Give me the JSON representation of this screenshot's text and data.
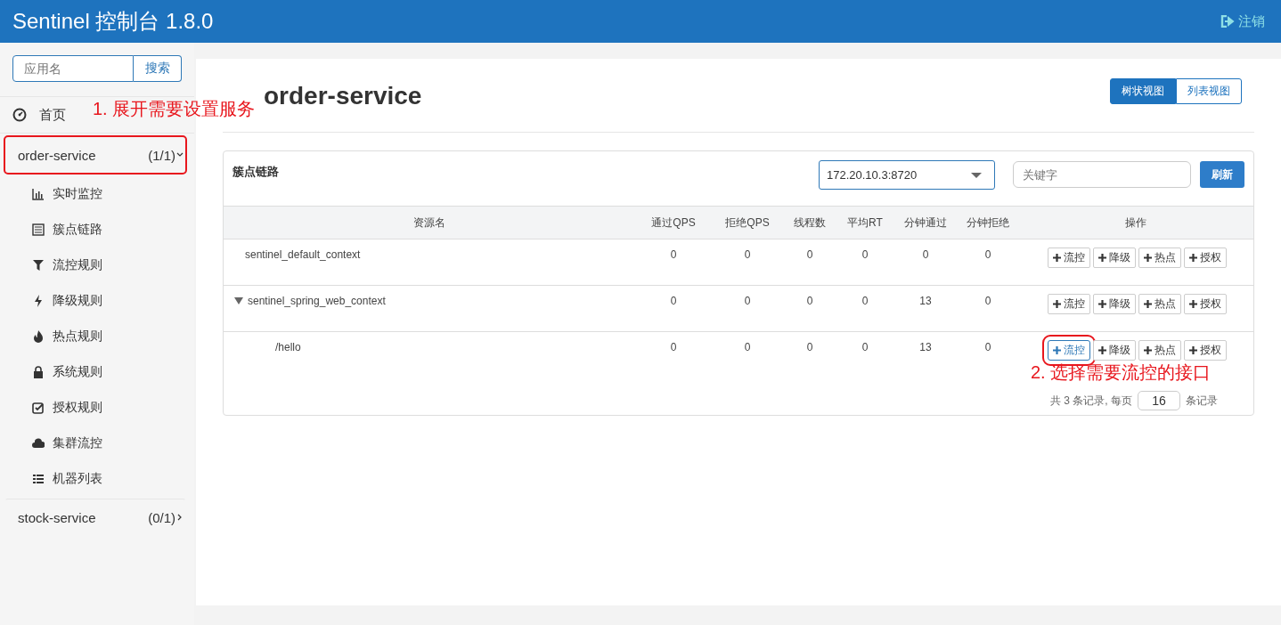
{
  "header": {
    "title": "Sentinel 控制台 1.8.0",
    "logout": "注销"
  },
  "sidebar": {
    "search": {
      "placeholder": "应用名",
      "button": "搜索"
    },
    "home": "首页",
    "apps": [
      {
        "name": "order-service",
        "count": "(1/1)",
        "expanded": true,
        "highlighted": true,
        "menu": [
          "实时监控",
          "簇点链路",
          "流控规则",
          "降级规则",
          "热点规则",
          "系统规则",
          "授权规则",
          "集群流控",
          "机器列表"
        ]
      },
      {
        "name": "stock-service",
        "count": "(0/1)",
        "expanded": false,
        "highlighted": false
      }
    ]
  },
  "page": {
    "title": "order-service",
    "views": [
      {
        "label": "树状视图",
        "selected": true
      },
      {
        "label": "列表视图",
        "selected": false
      }
    ]
  },
  "panel": {
    "title": "簇点链路",
    "machine": "172.20.10.3:8720",
    "keyword_placeholder": "关键字",
    "refresh": "刷新",
    "columns": [
      "资源名",
      "通过QPS",
      "拒绝QPS",
      "线程数",
      "平均RT",
      "分钟通过",
      "分钟拒绝",
      "操作"
    ],
    "rows": [
      {
        "name": "sentinel_default_context",
        "values": [
          "0",
          "0",
          "0",
          "0",
          "0",
          "0"
        ],
        "actions": [
          {
            "label": "流控",
            "selected": false,
            "highlighted": false
          },
          {
            "label": "降级",
            "selected": false,
            "highlighted": false
          },
          {
            "label": "热点",
            "selected": false,
            "highlighted": false
          },
          {
            "label": "授权",
            "selected": false,
            "highlighted": false
          }
        ]
      },
      {
        "name": "sentinel_spring_web_context",
        "expanded": true,
        "values": [
          "0",
          "0",
          "0",
          "0",
          "13",
          "0"
        ],
        "actions": [
          {
            "label": "流控",
            "selected": false,
            "highlighted": false
          },
          {
            "label": "降级",
            "selected": false,
            "highlighted": false
          },
          {
            "label": "热点",
            "selected": false,
            "highlighted": false
          },
          {
            "label": "授权",
            "selected": false,
            "highlighted": false
          }
        ],
        "children": [
          {
            "name": "/hello",
            "values": [
              "0",
              "0",
              "0",
              "0",
              "13",
              "0"
            ],
            "actions": [
              {
                "label": "流控",
                "selected": true,
                "highlighted": true
              },
              {
                "label": "降级",
                "selected": false,
                "highlighted": false
              },
              {
                "label": "热点",
                "selected": false,
                "highlighted": false
              },
              {
                "label": "授权",
                "selected": false,
                "highlighted": false
              }
            ]
          }
        ]
      }
    ],
    "pagination": {
      "before": "共 3 条记录, 每页",
      "page_size": "16",
      "after": "条记录"
    }
  },
  "annotations": [
    {
      "kind": "note",
      "text": "1. 展开需要设置服务"
    },
    {
      "kind": "note",
      "text": "2. 选择需要流控的接口"
    }
  ]
}
